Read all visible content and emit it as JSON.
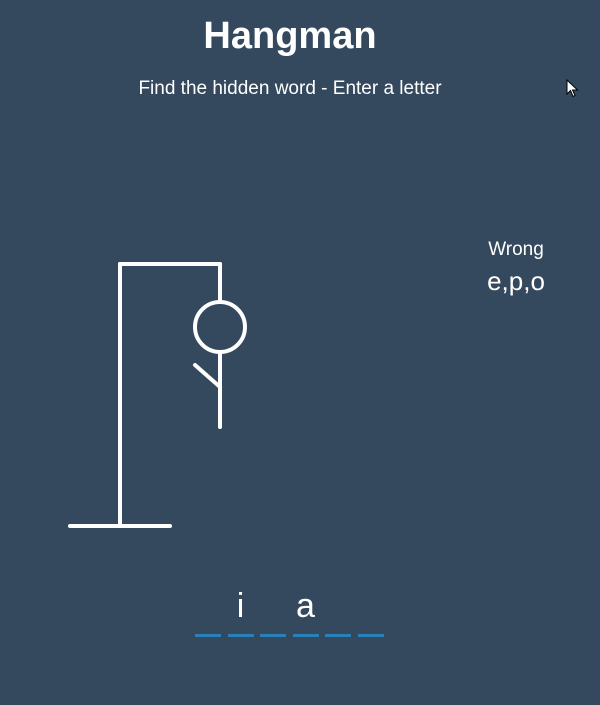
{
  "header": {
    "title": "Hangman",
    "subtitle": "Find the hidden word - Enter a letter"
  },
  "wrong": {
    "title": "Wrong",
    "letters": "e,p,o"
  },
  "word": {
    "letters": [
      "",
      "i",
      "",
      "a",
      "",
      ""
    ]
  },
  "colors": {
    "background": "#34495e",
    "underline": "#2980b9",
    "text": "#ffffff"
  },
  "figure": {
    "parts_shown": [
      "gallows-base",
      "gallows-pole",
      "gallows-beam",
      "gallows-rope",
      "head",
      "body",
      "left-arm"
    ]
  },
  "icons": {
    "cursor": "mouse-pointer-icon"
  }
}
